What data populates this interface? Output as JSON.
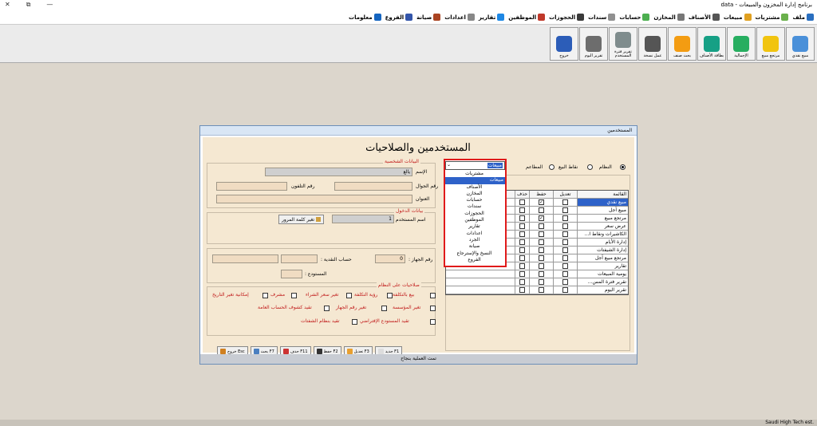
{
  "window": {
    "title": "برنامج إدارة المخزون والمبيعات - data",
    "controls": [
      "✕",
      "⧉",
      "—"
    ]
  },
  "menu": [
    {
      "label": "ملف",
      "color": "#2a6fc0"
    },
    {
      "label": "مشتريات",
      "color": "#6ab04c"
    },
    {
      "label": "مبيعات",
      "color": "#e0a020"
    },
    {
      "label": "الأصناف",
      "color": "#555555"
    },
    {
      "label": "المخازن",
      "color": "#777777"
    },
    {
      "label": "حسابات",
      "color": "#4caf50"
    },
    {
      "label": "سندات",
      "color": "#909090"
    },
    {
      "label": "الحجوزات",
      "color": "#3a3a3a"
    },
    {
      "label": "الموظفين",
      "color": "#c0392b"
    },
    {
      "label": "تقارير",
      "color": "#1e88e5"
    },
    {
      "label": "اعدادات",
      "color": "#888888"
    },
    {
      "label": "صيانة",
      "color": "#aa4422"
    },
    {
      "label": "الفروع",
      "color": "#3355aa"
    },
    {
      "label": "معلومات",
      "color": "#1565c0"
    }
  ],
  "toolbar": [
    {
      "label": "مبيع نقدي",
      "color": "#4a90d9"
    },
    {
      "label": "مرتجع مبيع",
      "color": "#f1c40f"
    },
    {
      "label": "الإجمالية",
      "color": "#27ae60"
    },
    {
      "label": "بطاقة الأصناف",
      "color": "#16a085"
    },
    {
      "label": "بحث صنف",
      "color": "#f39c12"
    },
    {
      "label": "عمل نسخة",
      "color": "#555555"
    },
    {
      "label": "تقرير فترة المستخدم",
      "color": "#7f8c8d"
    },
    {
      "label": "تقرير اليوم",
      "color": "#6d6d6d"
    },
    {
      "label": "خروج",
      "color": "#2c5db8"
    }
  ],
  "dialog": {
    "title": "المستخدمين",
    "heading": "المستخدمين والصلاحيات",
    "personal": {
      "group_title": "البيانات الشخصية",
      "name_label": "الإسم",
      "name_value": "يالع",
      "mobile_label": "رقم الجوال",
      "phone_label": "رقم التلفون",
      "address_label": "العنوان"
    },
    "login": {
      "group_title": "بيانات الدخول",
      "username_label": "اسم المستخدم",
      "username_value": "1",
      "change_password": "تغير كلمة المرور"
    },
    "device": {
      "device_label": "رقم الجهاز :",
      "device_value": "0",
      "cash_label": "حساب النقدية :",
      "warehouse_label": "المستودع :"
    },
    "perms": {
      "group_title": "صلاحيات على النظام",
      "items": [
        "بيع بالتكلفة",
        "رؤية التكلفة",
        "تغير سعر الشراء",
        "مشرف",
        "إمكانية تغير التاريخ",
        "تغير المؤسسة",
        "تغير رقم الجهاز",
        "تقيد كشوف الحساب العامة",
        "تقيد المستودع الإفتراضي",
        "تقيد بنظام الشفتات"
      ]
    },
    "type": {
      "options": [
        "النظام",
        "نقاط البيع",
        "المطاعم"
      ],
      "selected": 0
    },
    "table": {
      "headers": [
        "القائمة",
        "تعديل",
        "حفظ",
        "حذف"
      ],
      "rows": [
        {
          "name": "مبيع نقدي",
          "edit": false,
          "save": true,
          "del": false,
          "selected": true
        },
        {
          "name": "مبيع آجل",
          "edit": false,
          "save": false,
          "del": false
        },
        {
          "name": "مرتجع مبيع",
          "edit": false,
          "save": true,
          "del": false
        },
        {
          "name": "عرض سعر",
          "edit": false,
          "save": false,
          "del": false
        },
        {
          "name": "الكاشيرات ونقاط ا...",
          "edit": false,
          "save": false,
          "del": false
        },
        {
          "name": "إدارة الأيام",
          "edit": false,
          "save": false,
          "del": false
        },
        {
          "name": "إدارة الشيفتات",
          "edit": false,
          "save": false,
          "del": false
        },
        {
          "name": "مرتجع مبيع آجل",
          "edit": false,
          "save": false,
          "del": false
        },
        {
          "name": "تقارير",
          "edit": false,
          "save": false,
          "del": false
        },
        {
          "name": "يومية المبيعات",
          "edit": false,
          "save": false,
          "del": false
        },
        {
          "name": "تقرير فترة المس...",
          "edit": false,
          "save": false,
          "del": false
        },
        {
          "name": "تقرير اليوم",
          "edit": false,
          "save": false,
          "del": false
        }
      ]
    },
    "dropdown": {
      "value": "مبيعات",
      "items": [
        "مشتريات",
        "مبيعات",
        "الأصناف",
        "المخازن",
        "حسابات",
        "سندات",
        "الحجوزات",
        "الموظفين",
        "تقارير",
        "اعدادات",
        "الجرد",
        "صيانة",
        "النسخ والإسترجاع",
        "الفروع"
      ],
      "selected_index": 1
    },
    "buttons": [
      {
        "label": "جديد F1",
        "color": "#dddddd"
      },
      {
        "label": "تعديل F3",
        "color": "#e8a030"
      },
      {
        "label": "حفظ F2",
        "color": "#333333"
      },
      {
        "label": "حذف F11",
        "color": "#cc3333"
      },
      {
        "label": "بحث F7",
        "color": "#4a7fc0"
      },
      {
        "label": "خروج Esc",
        "color": "#d08020"
      }
    ],
    "status": "تمت العملية بنجاح"
  },
  "statusbar": "Saudi High Tech est."
}
